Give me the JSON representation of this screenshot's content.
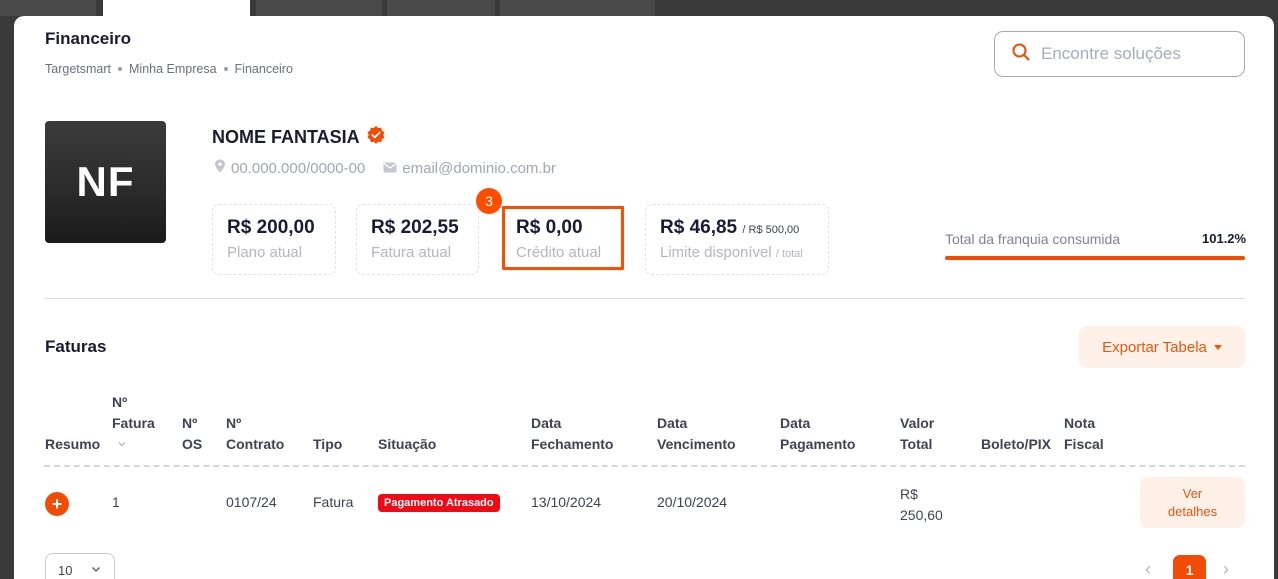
{
  "header": {
    "title": "Financeiro",
    "breadcrumb": [
      "Targetsmart",
      "Minha Empresa",
      "Financeiro"
    ]
  },
  "search": {
    "placeholder": "Encontre soluções",
    "icon": "search-icon"
  },
  "company": {
    "avatar_initials": "NF",
    "name": "NOME FANTASIA",
    "document": "00.000.000/0000-00",
    "email": "email@dominio.com.br"
  },
  "stats": {
    "plano": {
      "value": "R$ 200,00",
      "label": "Plano atual"
    },
    "fatura": {
      "value": "R$ 202,55",
      "label": "Fatura atual"
    },
    "credito": {
      "value": "R$ 0,00",
      "label": "Crédito atual"
    },
    "limite": {
      "value": "R$ 46,85",
      "value_suffix": "/ R$ 500,00",
      "label": "Limite disponível",
      "label_suffix": "/ total"
    }
  },
  "annotation": {
    "step": "3"
  },
  "franquia": {
    "label": "Total da franquia consumida",
    "percent_text": "101.2%",
    "fill_fraction": 1.0
  },
  "faturas": {
    "title": "Faturas",
    "export_label": "Exportar Tabela",
    "columns": {
      "resumo": "Resumo",
      "n_fatura_1": "Nº",
      "n_fatura_2": "Fatura",
      "n_os_1": "Nº",
      "n_os_2": "OS",
      "n_contrato_1": "Nº",
      "n_contrato_2": "Contrato",
      "tipo": "Tipo",
      "situacao": "Situação",
      "data_fech_1": "Data",
      "data_fech_2": "Fechamento",
      "data_venc_1": "Data",
      "data_venc_2": "Vencimento",
      "data_pag_1": "Data",
      "data_pag_2": "Pagamento",
      "valor_1": "Valor",
      "valor_2": "Total",
      "boleto": "Boleto/PIX",
      "nota_1": "Nota",
      "nota_2": "Fiscal"
    },
    "rows": [
      {
        "expand": "+",
        "n_fatura": "1",
        "n_os": "",
        "n_contrato": "0107/24",
        "tipo": "Fatura",
        "situacao": "Pagamento Atrasado",
        "data_fechamento": "13/10/2024",
        "data_vencimento": "20/10/2024",
        "data_pagamento": "",
        "valor_1": "R$",
        "valor_2": "250,60",
        "action_1": "Ver",
        "action_2": "detalhes"
      }
    ]
  },
  "pagination": {
    "page_size": "10",
    "current_page": "1",
    "prev": "‹",
    "next": "›"
  },
  "colors": {
    "accent": "#f14b05",
    "danger": "#f10a16",
    "accent_soft": "#fff0e8"
  }
}
